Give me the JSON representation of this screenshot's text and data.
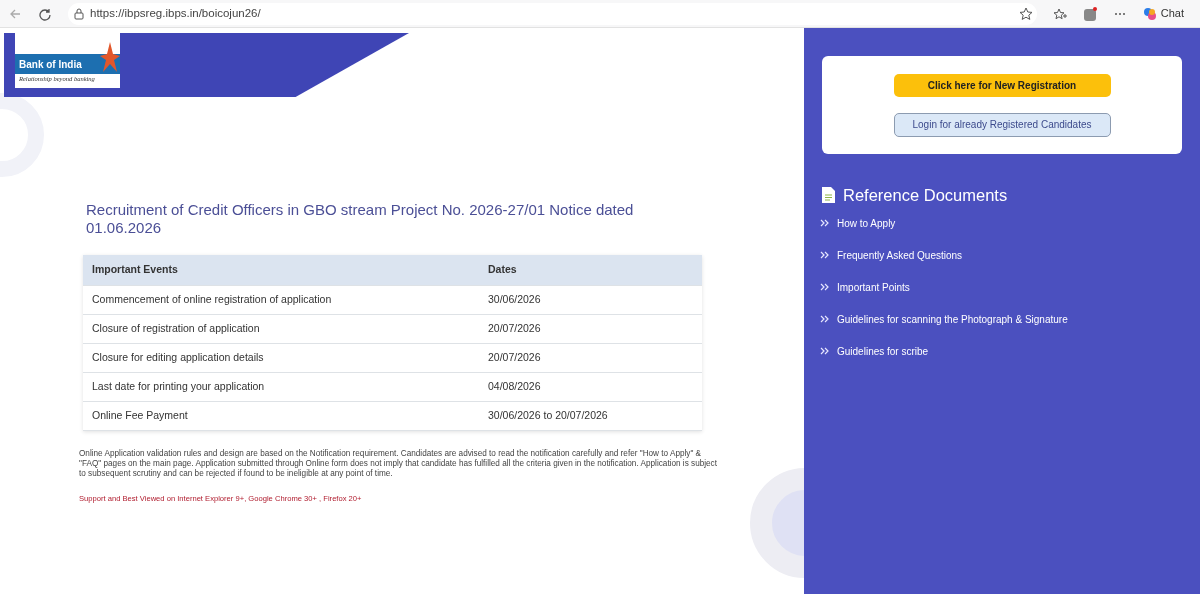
{
  "browser": {
    "url": "https://ibpsreg.ibps.in/boicojun26/",
    "chat_label": "Chat"
  },
  "logo": {
    "name": "Bank of India",
    "tagline": "Relationship beyond banking"
  },
  "title": "Recruitment of Credit Officers in GBO stream Project No. 2026-27/01 Notice dated 01.06.2026",
  "table": {
    "columns": [
      "Important Events",
      "Dates"
    ],
    "rows": [
      [
        "Commencement of online registration of application",
        "30/06/2026"
      ],
      [
        "Closure of registration of application",
        "20/07/2026"
      ],
      [
        "Closure for editing application details",
        "20/07/2026"
      ],
      [
        "Last date for printing your application",
        "04/08/2026"
      ],
      [
        "Online Fee Payment",
        "30/06/2026 to 20/07/2026"
      ]
    ]
  },
  "note": "Online Application validation rules and design are based on the Notification requirement. Candidates are advised to read the notification carefully and refer \"How to Apply\" & \"FAQ\" pages on the main page. Application submitted through Online form does not imply that candidate has fulfilled all the criteria given in the notification. Application is subject to subsequent scrutiny and can be rejected if found to be ineligible at any point of time.",
  "support_note": "Support and Best Viewed on Internet Explorer 9+, Google Chrome 30+ , Firefox 20+",
  "buttons": [
    {
      "label": "Click here for New Registration",
      "kind": "primary"
    },
    {
      "label": "Login for already Registered Candidates",
      "kind": "secondary"
    }
  ],
  "reference": {
    "heading": "Reference Documents",
    "links": [
      "How to Apply",
      "Frequently Asked Questions",
      "Important Points",
      "Guidelines for scanning the Photograph & Signature",
      "Guidelines for scribe"
    ]
  }
}
